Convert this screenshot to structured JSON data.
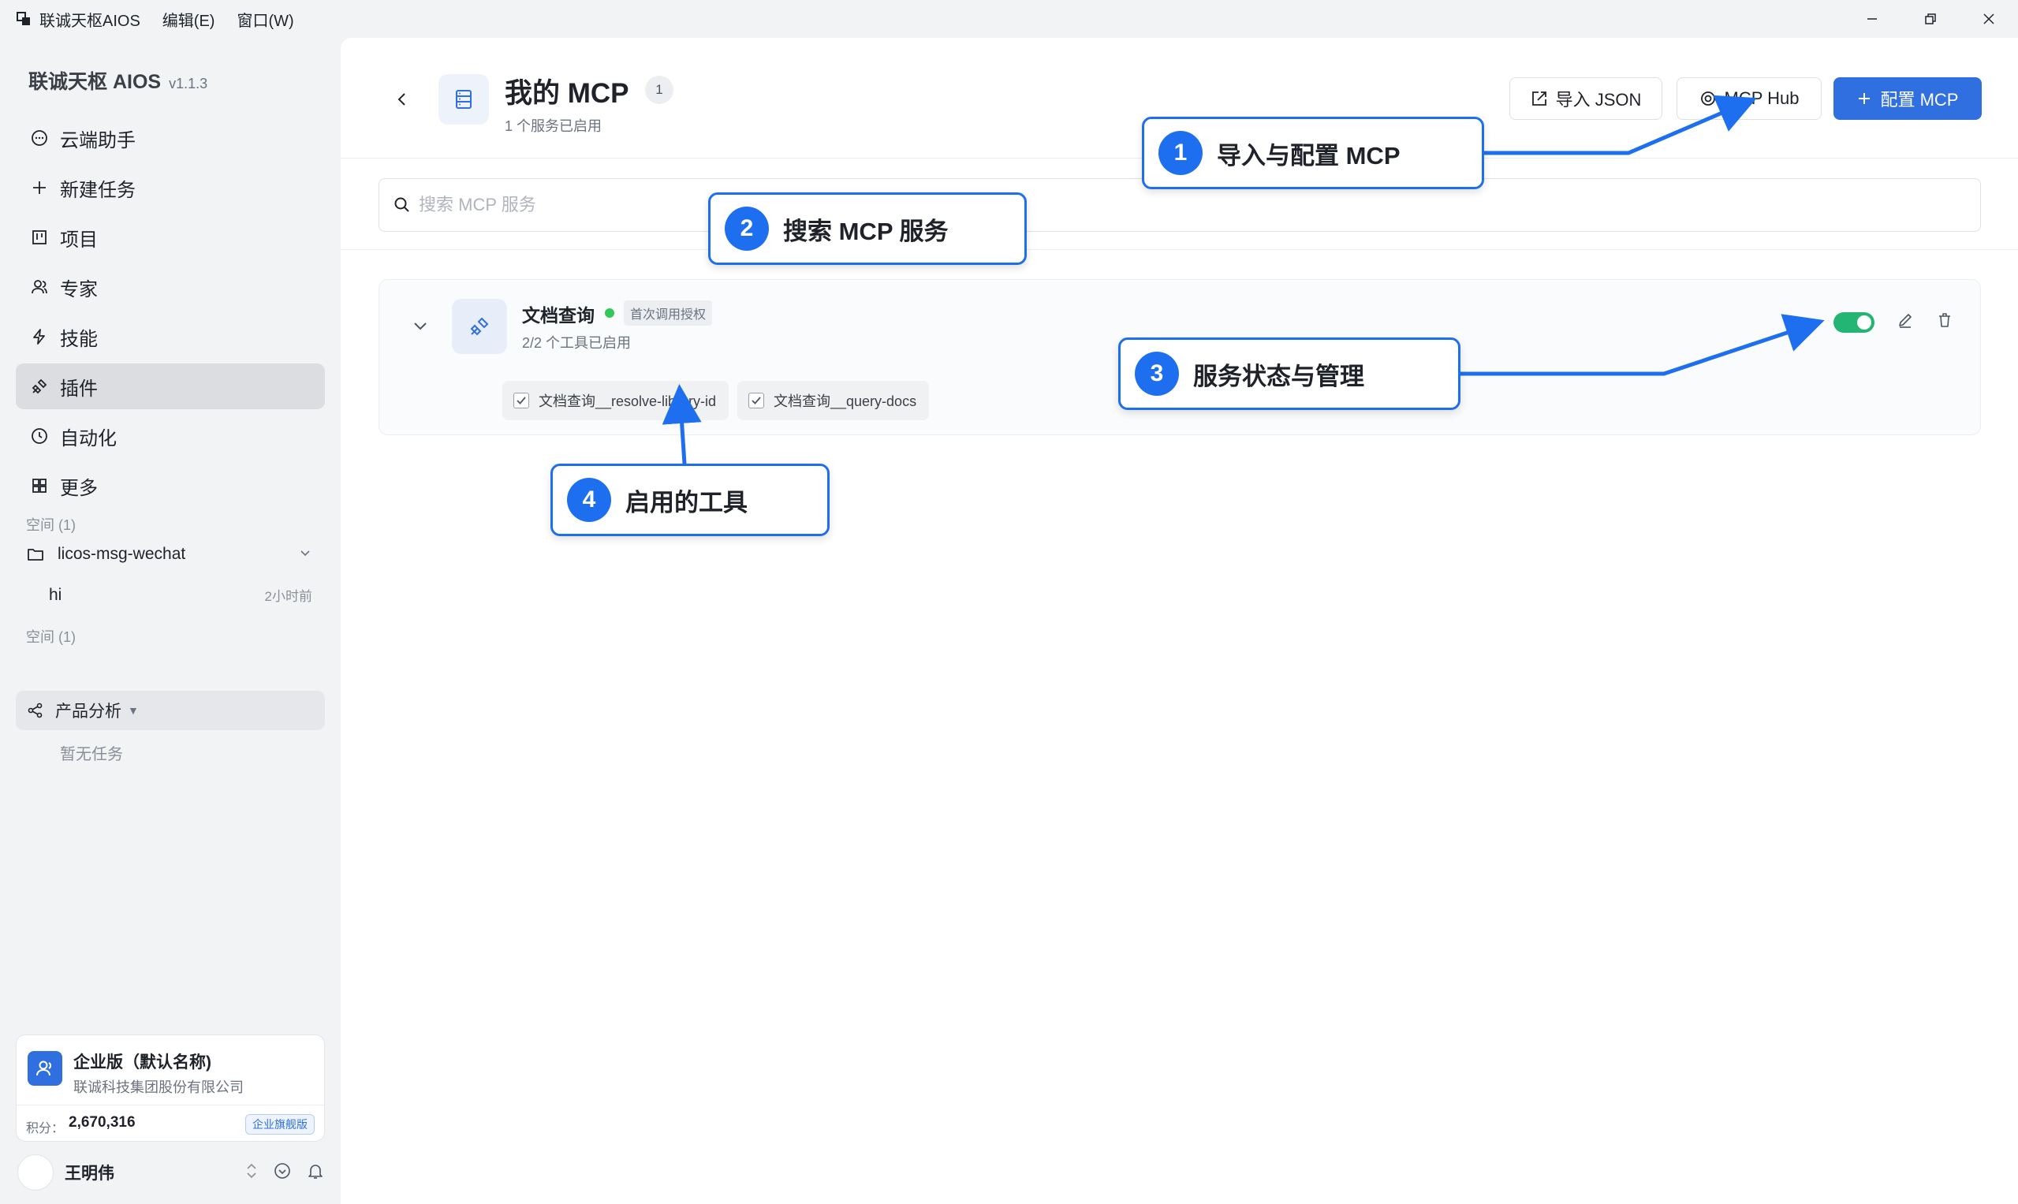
{
  "titlebar": {
    "app_name": "联诚天枢AIOS",
    "menus": [
      "编辑(E)",
      "窗口(W)"
    ]
  },
  "sidebar": {
    "brand": "联诚天枢 AIOS",
    "version": "v1.1.3",
    "nav": [
      {
        "label": "云端助手",
        "icon": "chat-icon"
      },
      {
        "label": "新建任务",
        "icon": "plus-icon"
      },
      {
        "label": "项目",
        "icon": "kanban-icon"
      },
      {
        "label": "专家",
        "icon": "users-icon"
      },
      {
        "label": "技能",
        "icon": "lightning-icon"
      },
      {
        "label": "插件",
        "icon": "plug-icon",
        "active": true
      },
      {
        "label": "自动化",
        "icon": "clock-icon"
      },
      {
        "label": "更多",
        "icon": "grid-icon"
      }
    ],
    "space_label_1": "空间 (1)",
    "space_1_name": "licos-msg-wechat",
    "task_name": "hi",
    "task_time": "2小时前",
    "space_label_2": "空间 (1)",
    "product_space": "产品分析",
    "empty_tasks": "暂无任务",
    "enterprise": {
      "name": "企业版（默认名称)",
      "org": "联诚科技集团股份有限公司",
      "points_label": "积分：",
      "points_value": "2,670,316",
      "badge": "企业旗舰版"
    },
    "user_name": "王明伟"
  },
  "main": {
    "title": "我的 MCP",
    "count": "1",
    "subtitle": "1 个服务已启用",
    "buttons": {
      "import_json": "导入 JSON",
      "mcp_hub": "MCP Hub",
      "configure": "配置 MCP"
    },
    "search_placeholder": "搜索 MCP 服务",
    "service": {
      "name": "文档查询",
      "auth_tag": "首次调用授权",
      "tools_enabled": "2/2 个工具已启用",
      "enabled": true,
      "tools": [
        "文档查询__resolve-library-id",
        "文档查询__query-docs"
      ]
    }
  },
  "callouts": [
    {
      "num": "1",
      "text": "导入与配置 MCP"
    },
    {
      "num": "2",
      "text": "搜索 MCP 服务"
    },
    {
      "num": "3",
      "text": "服务状态与管理"
    },
    {
      "num": "4",
      "text": "启用的工具"
    }
  ],
  "colors": {
    "accent": "#2f6fe0",
    "callout_blue": "#1e6ff0",
    "toggle_on": "#22b573",
    "status_green": "#34c759"
  }
}
